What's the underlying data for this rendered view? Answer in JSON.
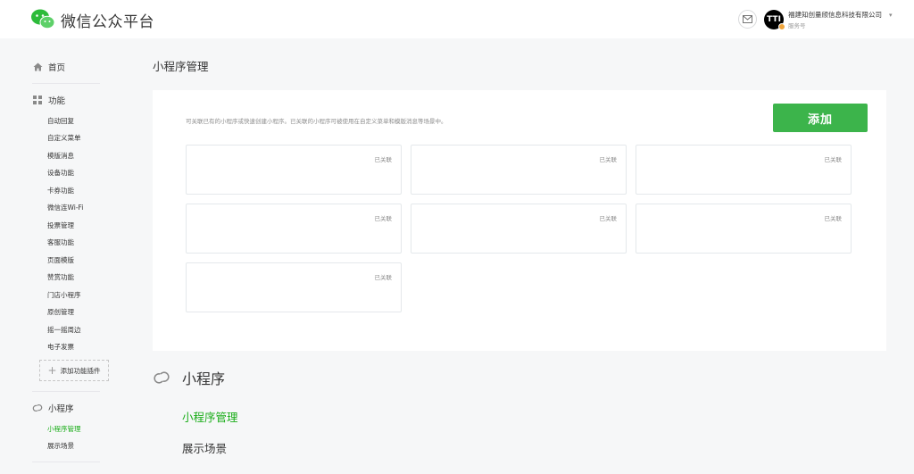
{
  "header": {
    "brand": "微信公众平台",
    "account_name": "福建知创量颀信息科技有限公司",
    "account_type": "服务号",
    "avatar_text": "TTI"
  },
  "sidebar": {
    "home": "首页",
    "features_title": "功能",
    "features": [
      "自动回复",
      "自定义菜单",
      "模版消息",
      "设备功能",
      "卡券功能",
      "微信连Wi-Fi",
      "投票管理",
      "客服功能",
      "页面模版",
      "赞赏功能",
      "门店小程序",
      "原创管理",
      "摇一摇周边",
      "电子发票"
    ],
    "add_plugin": "添加功能插件",
    "miniprogram_title": "小程序",
    "miniprogram_items": [
      "小程序管理",
      "展示场景"
    ],
    "active_item": "小程序管理"
  },
  "main": {
    "page_title": "小程序管理",
    "description": "可关联已有的小程序或快速创建小程序。已关联的小程序可被使用在自定义菜单和模版消息等场景中。",
    "add_button": "添加",
    "cards": [
      "已关联",
      "已关联",
      "已关联",
      "已关联",
      "已关联",
      "已关联",
      "已关联"
    ],
    "section_title": "小程序",
    "section_link": "小程序管理",
    "section_sub": "展示场景"
  },
  "colors": {
    "accent": "#1aad19",
    "button": "#3cb44b",
    "background": "#f6f7f8"
  }
}
